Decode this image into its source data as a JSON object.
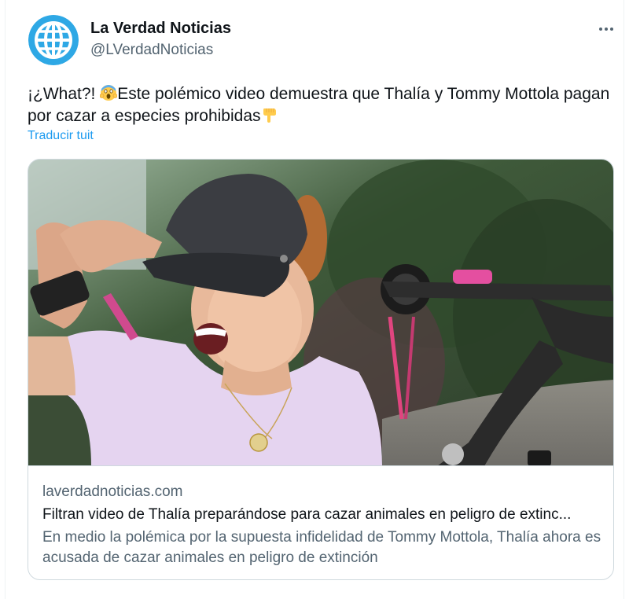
{
  "author": {
    "name": "La Verdad Noticias",
    "handle": "@LVerdadNoticias",
    "avatar_icon": "globe-icon",
    "avatar_color": "#2ea8e5"
  },
  "tweet": {
    "text_part1": "¡¿What?! ",
    "emoji1": "screaming-face-emoji",
    "text_part2": "Este polémico video demuestra que Thalía y Tommy Mottola pagan por cazar a especies prohibidas",
    "emoji2": "pointing-down-emoji",
    "translate_label": "Traducir tuit"
  },
  "card": {
    "image_alt": "Mujer con gorra negra riendo junto a un arco de caza",
    "domain": "laverdadnoticias.com",
    "title": "Filtran video de Thalía preparándose para cazar animales en peligro de extinc...",
    "description": "En medio la polémica por la supuesta infidelidad de Tommy Mottola, Thalía ahora es acusada de cazar animales en peligro de extinción"
  },
  "colors": {
    "link": "#1d9bf0",
    "secondary_text": "#536471",
    "border": "#cfd9de"
  }
}
